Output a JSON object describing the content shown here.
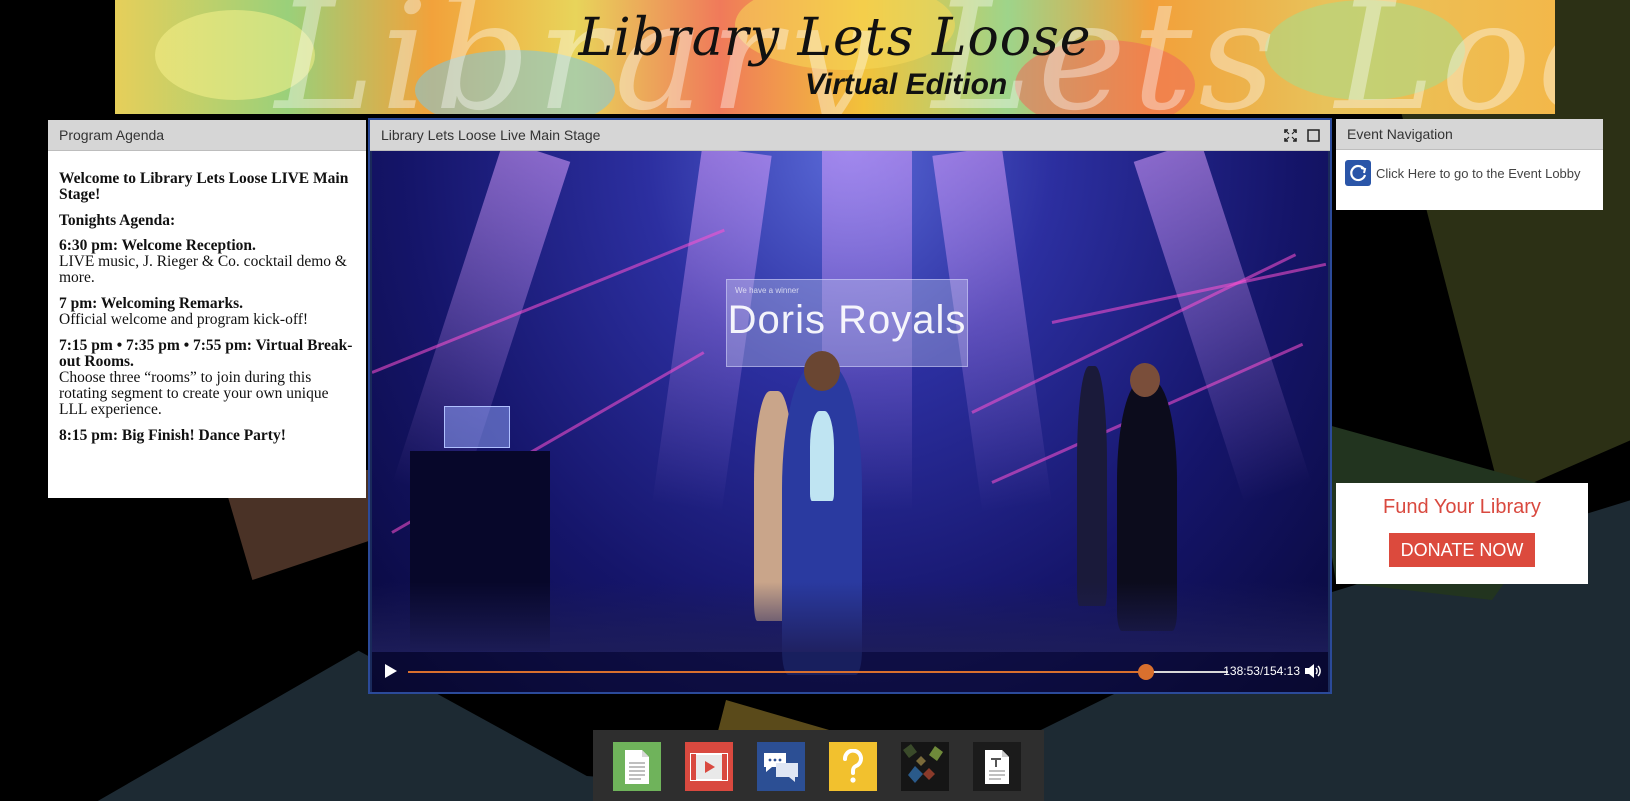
{
  "banner": {
    "title": "Library Lets Loose",
    "subtitle": "Virtual Edition"
  },
  "agenda": {
    "header": "Program Agenda",
    "welcome": "Welcome to Library Lets Loose LIVE Main Stage!",
    "tonights": "Tonights Agenda:",
    "items": [
      {
        "title": "6:30 pm: Welcome Reception.",
        "desc": "LIVE music, J. Rieger & Co. cocktail demo & more."
      },
      {
        "title": "7 pm: Welcoming Remarks.",
        "desc": "Official welcome and program kick-off!"
      },
      {
        "title": "7:15 pm • 7:35 pm • 7:55 pm: Virtual Break-out Rooms.",
        "desc": "Choose three “rooms” to join during this rotating segment to create your own unique LLL experience."
      },
      {
        "title": "8:15 pm: Big Finish! Dance Party!",
        "desc": ""
      }
    ]
  },
  "stage": {
    "header": "Library Lets Loose Live Main Stage",
    "icons": [
      "fullscreen-icon",
      "maximize-icon"
    ],
    "video": {
      "screen_small_text": "We have a winner",
      "screen_name": "Doris Royals",
      "time_current": "138:53",
      "time_total": "154:13",
      "progress": 0.9,
      "accent": "#d9702e"
    }
  },
  "eventnav": {
    "header": "Event Navigation",
    "lobby_link": "Click Here to go to the Event Lobby",
    "icon": "lobby-icon"
  },
  "fund": {
    "title": "Fund Your Library",
    "button": "DONATE NOW",
    "color": "#dc4a3d"
  },
  "dock": {
    "items": [
      {
        "name": "document-icon",
        "color": "#6fb35b"
      },
      {
        "name": "video-icon",
        "color": "#d9493f"
      },
      {
        "name": "chat-icon",
        "color": "#2c4f94"
      },
      {
        "name": "help-icon",
        "color": "#f2c12e"
      },
      {
        "name": "diamonds-icon",
        "color": "#151515"
      },
      {
        "name": "text-file-icon",
        "color": "#1b1b1b"
      }
    ]
  }
}
